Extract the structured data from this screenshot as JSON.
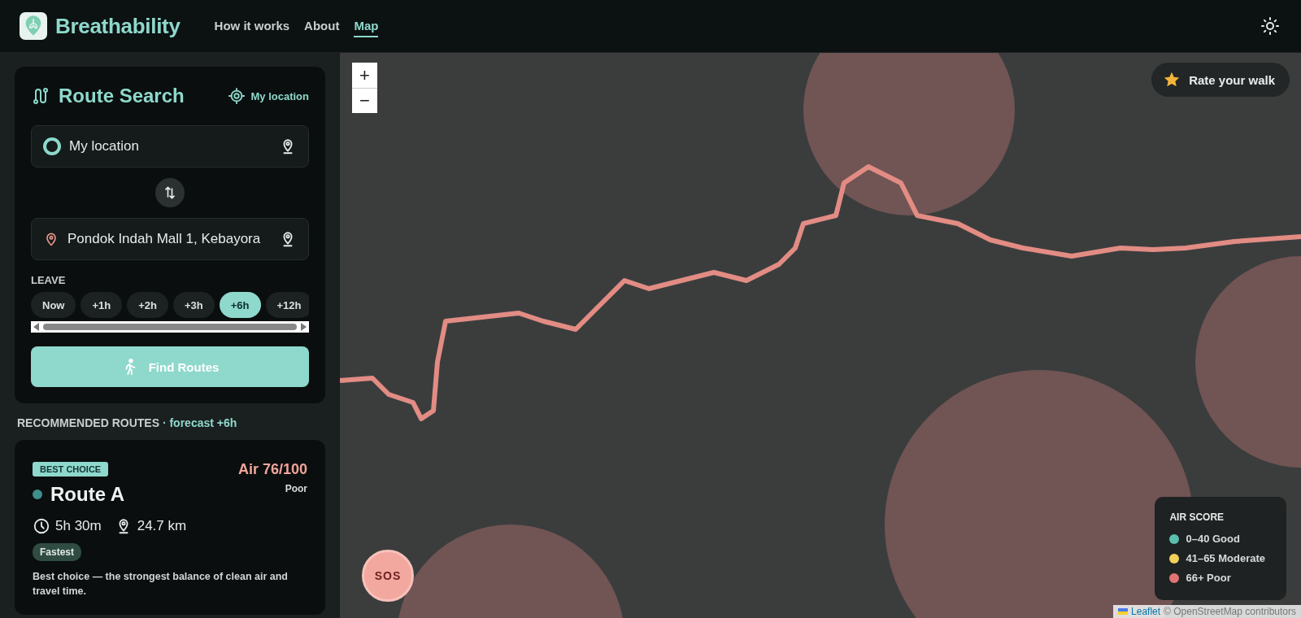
{
  "header": {
    "brand": "Breathability",
    "nav": [
      {
        "label": "How it works",
        "selected": false
      },
      {
        "label": "About",
        "selected": false
      },
      {
        "label": "Map",
        "selected": true
      }
    ]
  },
  "route_search": {
    "title": "Route Search",
    "locate_button": "My location",
    "origin": {
      "value": "My location"
    },
    "destination": {
      "value": "Pondok Indah Mall 1, Kebayora"
    },
    "leave_label": "LEAVE",
    "leave_options": [
      {
        "label": "Now",
        "selected": false
      },
      {
        "label": "+1h",
        "selected": false
      },
      {
        "label": "+2h",
        "selected": false
      },
      {
        "label": "+3h",
        "selected": false
      },
      {
        "label": "+6h",
        "selected": true
      },
      {
        "label": "+12h",
        "selected": false
      }
    ],
    "find_button": "Find Routes"
  },
  "recommended": {
    "heading": "RECOMMENDED ROUTES",
    "forecast": "· forecast +6h",
    "routes": [
      {
        "badge": "BEST CHOICE",
        "name": "Route A",
        "color": "#3f8f8b",
        "air_score": "Air 76/100",
        "rating_label": "Poor",
        "duration": "5h 30m",
        "distance": "24.7 km",
        "tag": "Fastest",
        "description": "Best choice — the strongest balance of clean air and travel time."
      }
    ]
  },
  "map": {
    "zoom_in": "+",
    "zoom_out": "−",
    "rate_button": "Rate your walk",
    "sos_button": "SOS",
    "legend": {
      "title": "AIR SCORE",
      "items": [
        {
          "label": "0–40 Good",
          "color": "#5bbfb0"
        },
        {
          "label": "41–65 Moderate",
          "color": "#f2cf5b"
        },
        {
          "label": "66+ Poor",
          "color": "#e07474"
        }
      ]
    },
    "attribution": {
      "link": "Leaflet",
      "text": "© OpenStreetMap contributors"
    }
  }
}
